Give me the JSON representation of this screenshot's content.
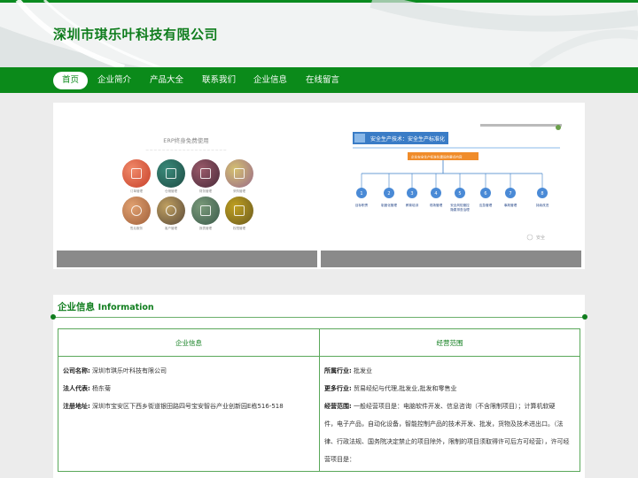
{
  "header": {
    "title": "深圳市琪乐叶科技有限公司"
  },
  "nav": {
    "items": [
      {
        "label": "首页",
        "active": true
      },
      {
        "label": "企业简介",
        "active": false
      },
      {
        "label": "产品大全",
        "active": false
      },
      {
        "label": "联系我们",
        "active": false
      },
      {
        "label": "企业信息",
        "active": false
      },
      {
        "label": "在线留言",
        "active": false
      }
    ]
  },
  "banner": {
    "slides": [
      {
        "title": "ERP终身免费使用",
        "modules": [
          "订单管理",
          "仓储管理",
          "财务管理",
          "采购管理",
          "售后服务",
          "客户管理",
          "报表管理",
          "权限管理"
        ]
      },
      {
        "header": "安全生产技术：安全生产标准化",
        "subtitle": "企业安全生产标准化建设的要点内容",
        "steps": [
          "目标职责",
          "制度化管理",
          "教育培训",
          "现场管理",
          "安全风险管控",
          "隐患排查治理",
          "应急管理",
          "事故管理",
          "持续改进"
        ],
        "watermark": "安全"
      }
    ]
  },
  "info": {
    "heading_cn": "企业信息",
    "heading_en": "Information",
    "left_header": "企业信息",
    "right_header": "经营范围",
    "left_rows": [
      {
        "label": "公司名称:",
        "value": "深圳市琪乐叶科技有限公司"
      },
      {
        "label": "法人代表:",
        "value": "杨东菊"
      },
      {
        "label": "注册地址:",
        "value": "深圳市宝安区下西乡街道银田路四号宝安智谷产业创新园E栋516-518"
      }
    ],
    "right_rows": [
      {
        "label": "所属行业:",
        "value": "批发业"
      },
      {
        "label": "更多行业:",
        "value": "贸易经纪与代理,批发业,批发和零售业"
      },
      {
        "label": "经营范围:",
        "value": "一般经营项目是：电脑软件开发、信息咨询（不含限制项目）；计算机软硬"
      }
    ],
    "scope_cont": [
      "件，电子产品，自动化设备，智能控制产品的技术开发、批发，货物及技术进出口。（法",
      "律、行政法规、国务院决定禁止的项目除外，限制的项目须取得许可后方可经营），许可经",
      "营项目是："
    ]
  },
  "colors": {
    "brand_green": "#0b8a1a",
    "title_green": "#0f7d1d",
    "border_green": "#5aa85a"
  }
}
